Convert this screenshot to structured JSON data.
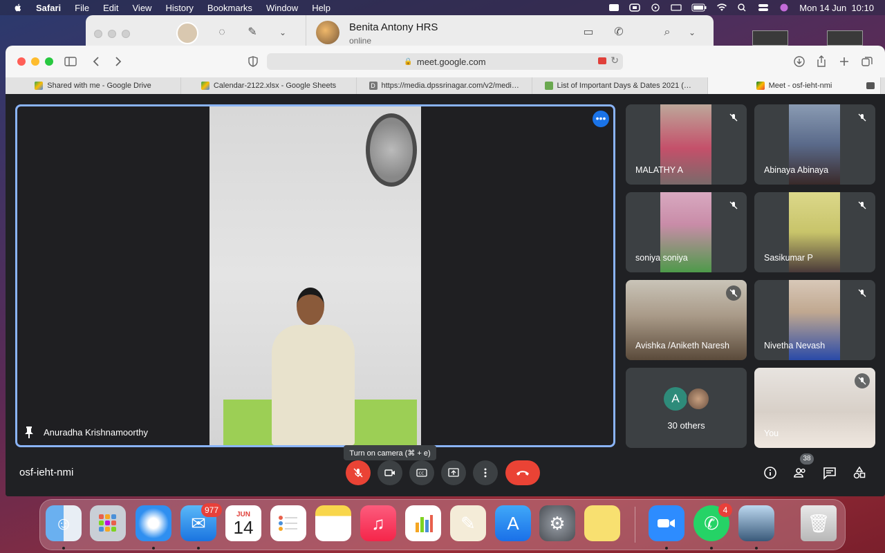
{
  "menubar": {
    "app_name": "Safari",
    "menus": [
      "File",
      "Edit",
      "View",
      "History",
      "Bookmarks",
      "Window",
      "Help"
    ],
    "clock": "Mon 14 Jun  10:10"
  },
  "whatsapp": {
    "contact_name": "Benita Antony HRS",
    "contact_status": "online"
  },
  "browser": {
    "url": "meet.google.com",
    "tabs": [
      {
        "label": "Shared with me - Google Drive",
        "icon": "google-drive-icon"
      },
      {
        "label": "Calendar-2122.xlsx - Google Sheets",
        "icon": "google-drive-icon"
      },
      {
        "label": "https://media.dpssrinagar.com/v2/media/...",
        "icon": "d-favicon-icon"
      },
      {
        "label": "List of Important Days & Dates 2021 (Nat...",
        "icon": "rocket-icon"
      },
      {
        "label": "Meet - osf-ieht-nmi",
        "icon": "google-meet-icon"
      }
    ]
  },
  "meet": {
    "main_speaker": "Anuradha Krishnamoorthy",
    "meeting_code": "osf-ieht-nmi",
    "tooltip": "Turn on camera (⌘ + e)",
    "participant_count": "38",
    "participants": [
      {
        "name": "MALATHY A",
        "muted": true
      },
      {
        "name": "Abinaya Abinaya",
        "muted": true
      },
      {
        "name": "soniya soniya",
        "muted": true
      },
      {
        "name": "Sasikumar P",
        "muted": true
      },
      {
        "name": "Avishka /Aniketh Naresh",
        "muted": true
      },
      {
        "name": "Nivetha Nevash",
        "muted": true
      }
    ],
    "others": {
      "initial": "A",
      "label": "30 others"
    },
    "self_label": "You"
  },
  "dock": {
    "calendar_month": "JUN",
    "calendar_day": "14",
    "mail_badge": "977",
    "whatsapp_badge": "4"
  }
}
